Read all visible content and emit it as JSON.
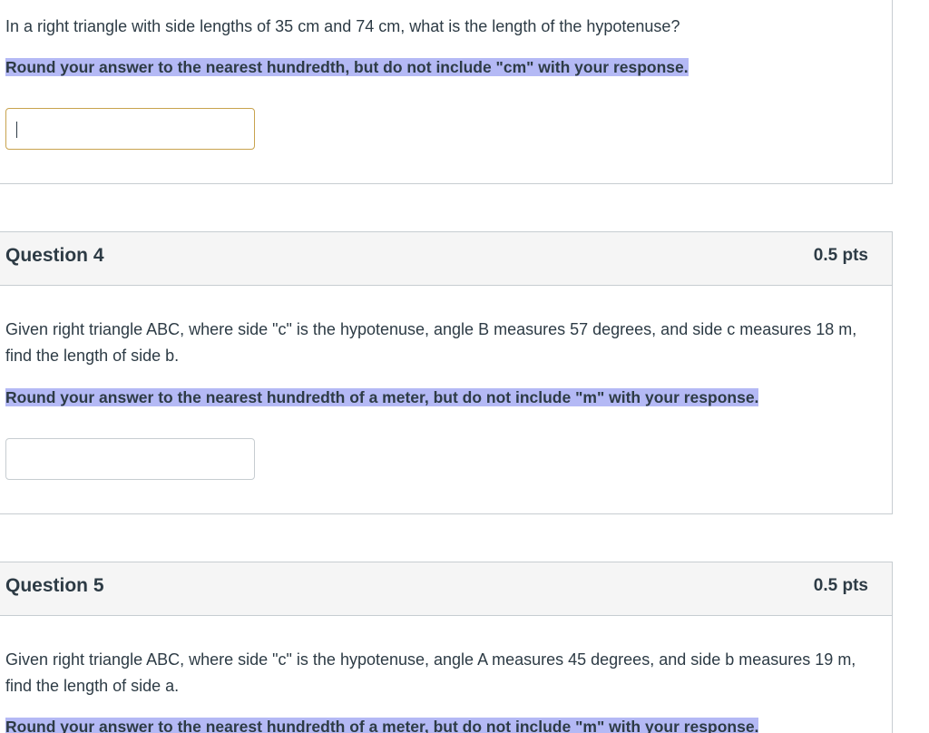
{
  "question3": {
    "text": "In a right triangle with side lengths of 35 cm and 74 cm, what is the length of the hypotenuse?",
    "note": "Round your answer to the nearest hundredth, but do not include \"cm\" with your response.",
    "answer_value": ""
  },
  "question4": {
    "title": "Question 4",
    "points": "0.5 pts",
    "text": "Given right triangle ABC, where side \"c\" is the hypotenuse, angle B measures 57 degrees, and side c measures 18 m, find the length of side b.",
    "note": "Round your answer to the nearest hundredth of a meter, but do not include \"m\" with your response.",
    "answer_value": ""
  },
  "question5": {
    "title": "Question 5",
    "points": "0.5 pts",
    "text": "Given right triangle ABC, where side \"c\" is the hypotenuse, angle A measures 45 degrees, and side b measures 19 m, find the length of side a.",
    "note": "Round your answer to the nearest hundredth of a meter, but do not include \"m\" with your response."
  },
  "colors": {
    "highlight": "#b4b9f5",
    "header_bg": "#f5f5f5",
    "border": "#c7cdd1",
    "focused_input_border": "#c8a34e",
    "text": "#2d3b45"
  }
}
